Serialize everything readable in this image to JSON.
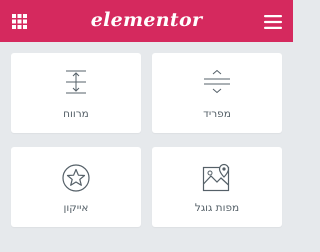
{
  "header": {
    "logo_text": "elementor",
    "background_color": "#d5295e",
    "left_icon": "grid-icon",
    "right_icon": "hamburger-menu-icon"
  },
  "widgets": [
    {
      "label": "מפריד",
      "icon": "divider-icon"
    },
    {
      "label": "מרווח",
      "icon": "spacer-icon"
    },
    {
      "label": "מפות גוגל",
      "icon": "map-icon"
    },
    {
      "label": "אייקון",
      "icon": "star-icon"
    }
  ]
}
